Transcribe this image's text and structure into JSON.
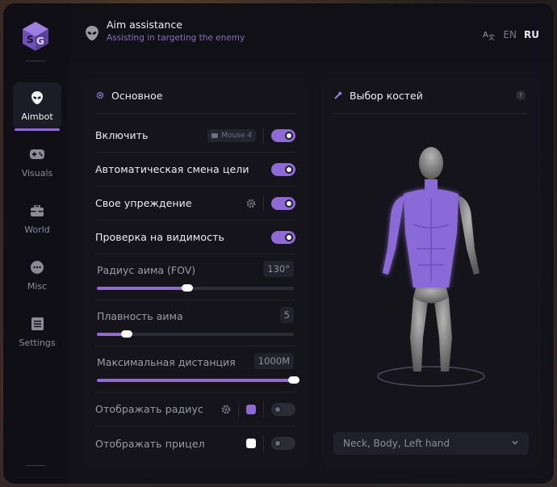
{
  "header": {
    "title": "Aim assistance",
    "subtitle": "Assisting in targeting the enemy",
    "lang_en": "EN",
    "lang_ru": "RU"
  },
  "sidebar": {
    "items": [
      {
        "label": "Aimbot",
        "icon": "alien-icon",
        "active": true
      },
      {
        "label": "Visuals",
        "icon": "gamepad-icon",
        "active": false
      },
      {
        "label": "World",
        "icon": "briefcase-icon",
        "active": false
      },
      {
        "label": "Misc",
        "icon": "chat-bubble-icon",
        "active": false
      },
      {
        "label": "Settings",
        "icon": "settings-list-icon",
        "active": false
      }
    ]
  },
  "main_panel": {
    "title": "Основное",
    "enable": {
      "label": "Включить",
      "key": "Mouse 4",
      "on": true
    },
    "auto_switch": {
      "label": "Автоматическая смена цели",
      "on": true
    },
    "prediction": {
      "label": "Свое упреждение",
      "on": true
    },
    "visibility": {
      "label": "Проверка на видимость",
      "on": true
    },
    "fov": {
      "label": "Радиус аима (FOV)",
      "value": "130°",
      "fraction": 0.46
    },
    "smooth": {
      "label": "Плавность аима",
      "value": "5",
      "fraction": 0.15
    },
    "distance": {
      "label": "Максимальная дистанция",
      "value": "1000M",
      "fraction": 1.0
    },
    "show_radius": {
      "label": "Отображать радиус",
      "color": "#8f6ad6",
      "on": false
    },
    "show_crosshair": {
      "label": "Отображать прицел",
      "color": "#ffffff",
      "on": false
    }
  },
  "bones_panel": {
    "title": "Выбор костей",
    "help": "?",
    "selected": "Neck, Body, Left hand"
  },
  "colors": {
    "accent": "#8f6ad6",
    "background": "#0f0f14"
  }
}
